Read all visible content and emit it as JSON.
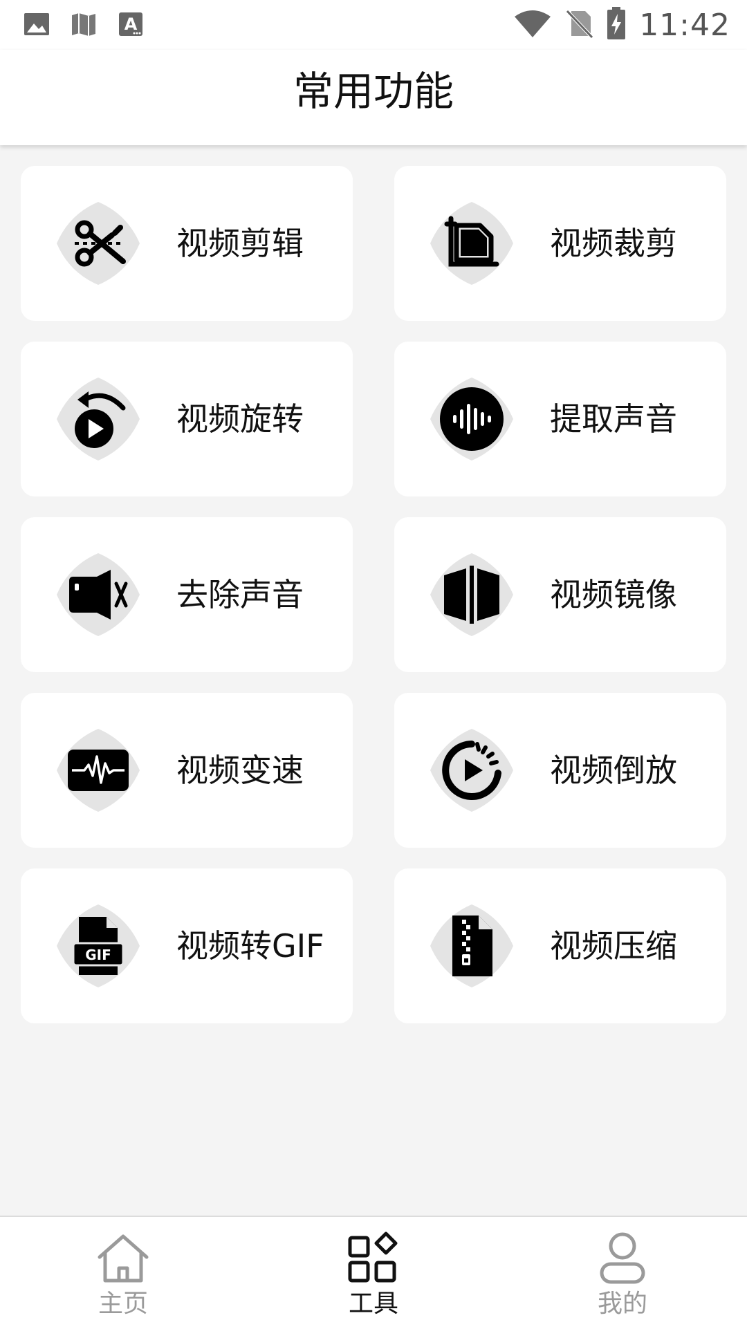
{
  "status_bar": {
    "time": "11:42",
    "left_icons": [
      "image-icon",
      "map-icon",
      "font-icon"
    ],
    "right_icons": [
      "wifi-icon",
      "no-sim-icon",
      "battery-charging-icon"
    ]
  },
  "header": {
    "title": "常用功能"
  },
  "tools": [
    {
      "label": "视频剪辑",
      "icon": "scissors-icon"
    },
    {
      "label": "视频裁剪",
      "icon": "crop-icon"
    },
    {
      "label": "视频旋转",
      "icon": "rotate-icon"
    },
    {
      "label": "提取声音",
      "icon": "audio-wave-icon"
    },
    {
      "label": "去除声音",
      "icon": "mute-icon"
    },
    {
      "label": "视频镜像",
      "icon": "mirror-icon"
    },
    {
      "label": "视频变速",
      "icon": "speed-wave-icon"
    },
    {
      "label": "视频倒放",
      "icon": "reverse-play-icon"
    },
    {
      "label": "视频转GIF",
      "icon": "gif-file-icon"
    },
    {
      "label": "视频压缩",
      "icon": "zip-file-icon"
    }
  ],
  "bottom_nav": {
    "items": [
      {
        "label": "主页",
        "icon": "home-icon",
        "active": false
      },
      {
        "label": "工具",
        "icon": "tools-grid-icon",
        "active": true
      },
      {
        "label": "我的",
        "icon": "profile-icon",
        "active": false
      }
    ]
  },
  "colors": {
    "background": "#f4f4f4",
    "card": "#ffffff",
    "icon_blob": "#e4e4e4",
    "icon_fg": "#000000",
    "nav_inactive": "#9a9a9a",
    "nav_active": "#111111"
  }
}
